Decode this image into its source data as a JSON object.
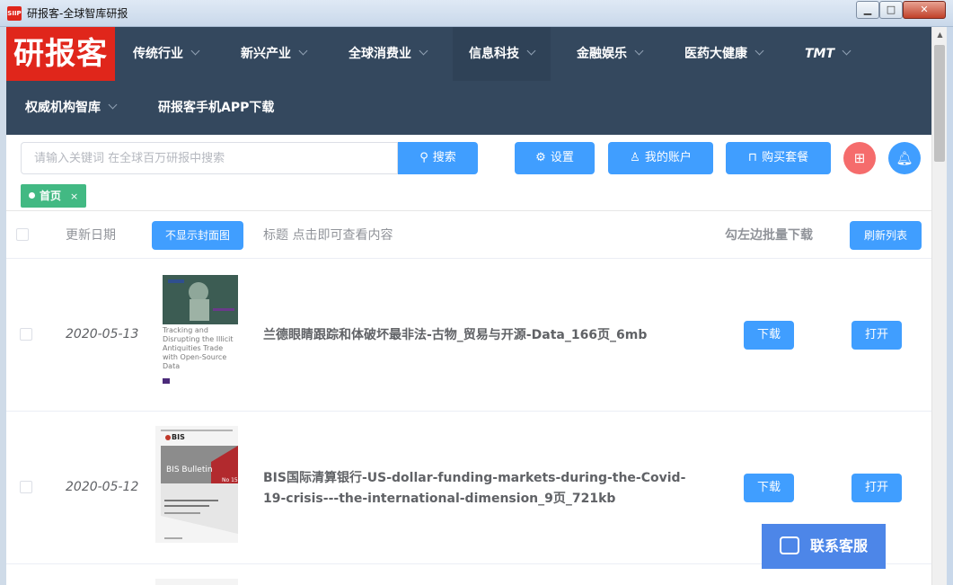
{
  "window": {
    "title": "研报客-全球智库研报",
    "app_icon": "SIIP",
    "min": "▁",
    "max": "□",
    "close": "✕"
  },
  "logo": "研报客",
  "nav": {
    "items": [
      "传统行业",
      "新兴产业",
      "全球消费业",
      "信息科技",
      "金融娱乐",
      "医药大健康",
      "TMT",
      "权威机构智库",
      "研报客手机APP下载"
    ]
  },
  "toolbar": {
    "search_placeholder": "请输入关键词 在全球百万研报中搜索",
    "search_label": "搜索",
    "settings_label": "设置",
    "account_label": "我的账户",
    "buy_label": "购买套餐"
  },
  "tabs": {
    "home": "首页",
    "close": "×"
  },
  "table": {
    "headers": {
      "date": "更新日期",
      "toggle_cover": "不显示封面图",
      "title": "标题 点击即可查看内容",
      "batch": "勾左边批量下载",
      "refresh": "刷新列表"
    },
    "rows": [
      {
        "date": "2020-05-13",
        "title": "兰德眼睛跟踪和体破坏最非法-古物_贸易与开源-Data_166页_6mb",
        "download": "下载",
        "open": "打开",
        "cover": {
          "text": "Tracking and Disrupting the Illicit Antiquities Trade with Open-Source Data"
        }
      },
      {
        "date": "2020-05-12",
        "title": "BIS国际清算银行-US-dollar-funding-markets-during-the-Covid-19-crisis---the-international-dimension_9页_721kb",
        "download": "下载",
        "open": "打开",
        "cover": {
          "brand": "BIS",
          "series": "BIS Bulletin",
          "number": "No 15"
        }
      }
    ]
  },
  "chat": {
    "label": "联系客服"
  },
  "colors": {
    "nav_bg": "#34485e",
    "logo_bg": "#e0261b",
    "primary": "#409eff",
    "tag": "#42b983",
    "danger": "#f56c6c"
  }
}
